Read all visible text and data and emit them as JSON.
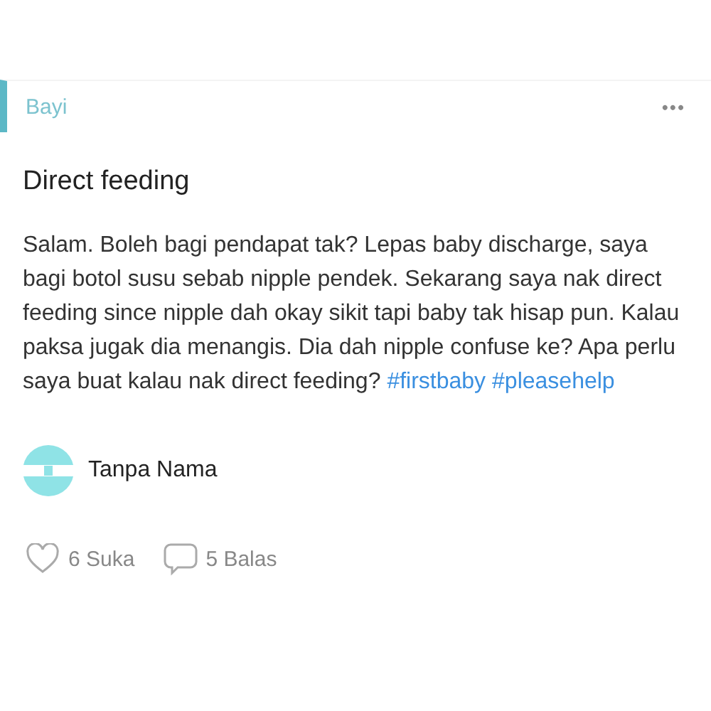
{
  "category": "Bayi",
  "menu": "•••",
  "title": "Direct feeding",
  "body": "Salam. Boleh bagi pendapat tak? Lepas baby discharge, saya bagi botol susu sebab nipple pendek. Sekarang saya nak direct feeding since nipple dah okay sikit tapi baby tak hisap pun. Kalau paksa jugak dia menangis. Dia dah nipple confuse ke? Apa perlu saya buat kalau nak direct feeding?",
  "hashtags": [
    "#firstbaby",
    "#pleasehelp"
  ],
  "author": {
    "name": "Tanpa Nama"
  },
  "actions": [
    {
      "kind": "like",
      "label": "6 Suka"
    },
    {
      "kind": "reply",
      "label": "5 Balas"
    }
  ]
}
